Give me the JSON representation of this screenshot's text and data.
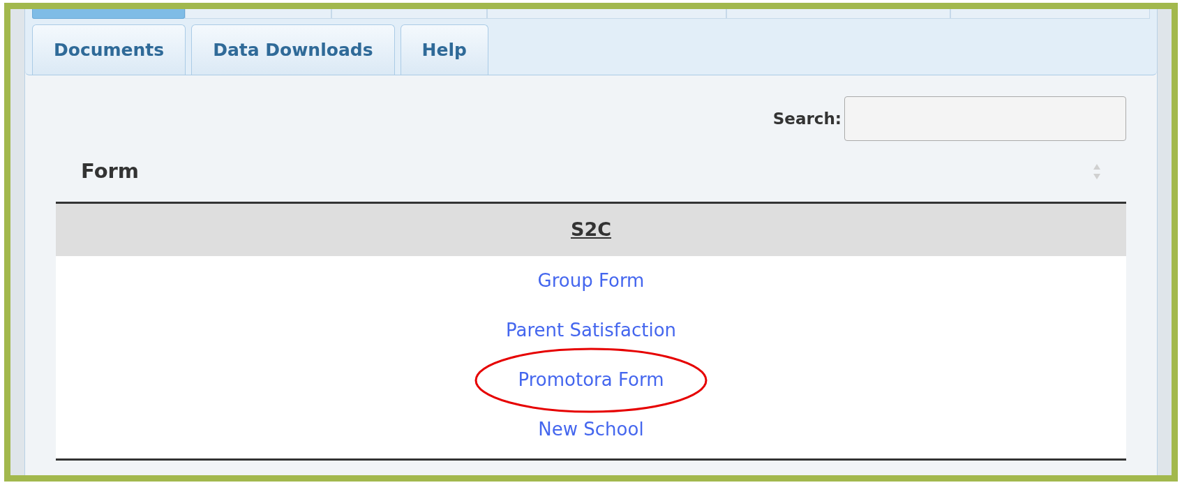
{
  "upper_tabs": [
    {
      "selected": true
    },
    {
      "selected": false
    },
    {
      "selected": false
    },
    {
      "selected": false
    },
    {
      "selected": false
    },
    {
      "selected": false
    }
  ],
  "tabs": [
    {
      "label": "Documents",
      "selected": false
    },
    {
      "label": "Data Downloads",
      "selected": false
    },
    {
      "label": "Help",
      "selected": false
    }
  ],
  "search": {
    "label": "Search:"
  },
  "table": {
    "column": "Form",
    "group": "S2C",
    "rows": [
      {
        "label": "Group Form",
        "highlighted": false
      },
      {
        "label": "Parent Satisfaction",
        "highlighted": false
      },
      {
        "label": "Promotora Form",
        "highlighted": true
      },
      {
        "label": "New School",
        "highlighted": false
      }
    ]
  }
}
